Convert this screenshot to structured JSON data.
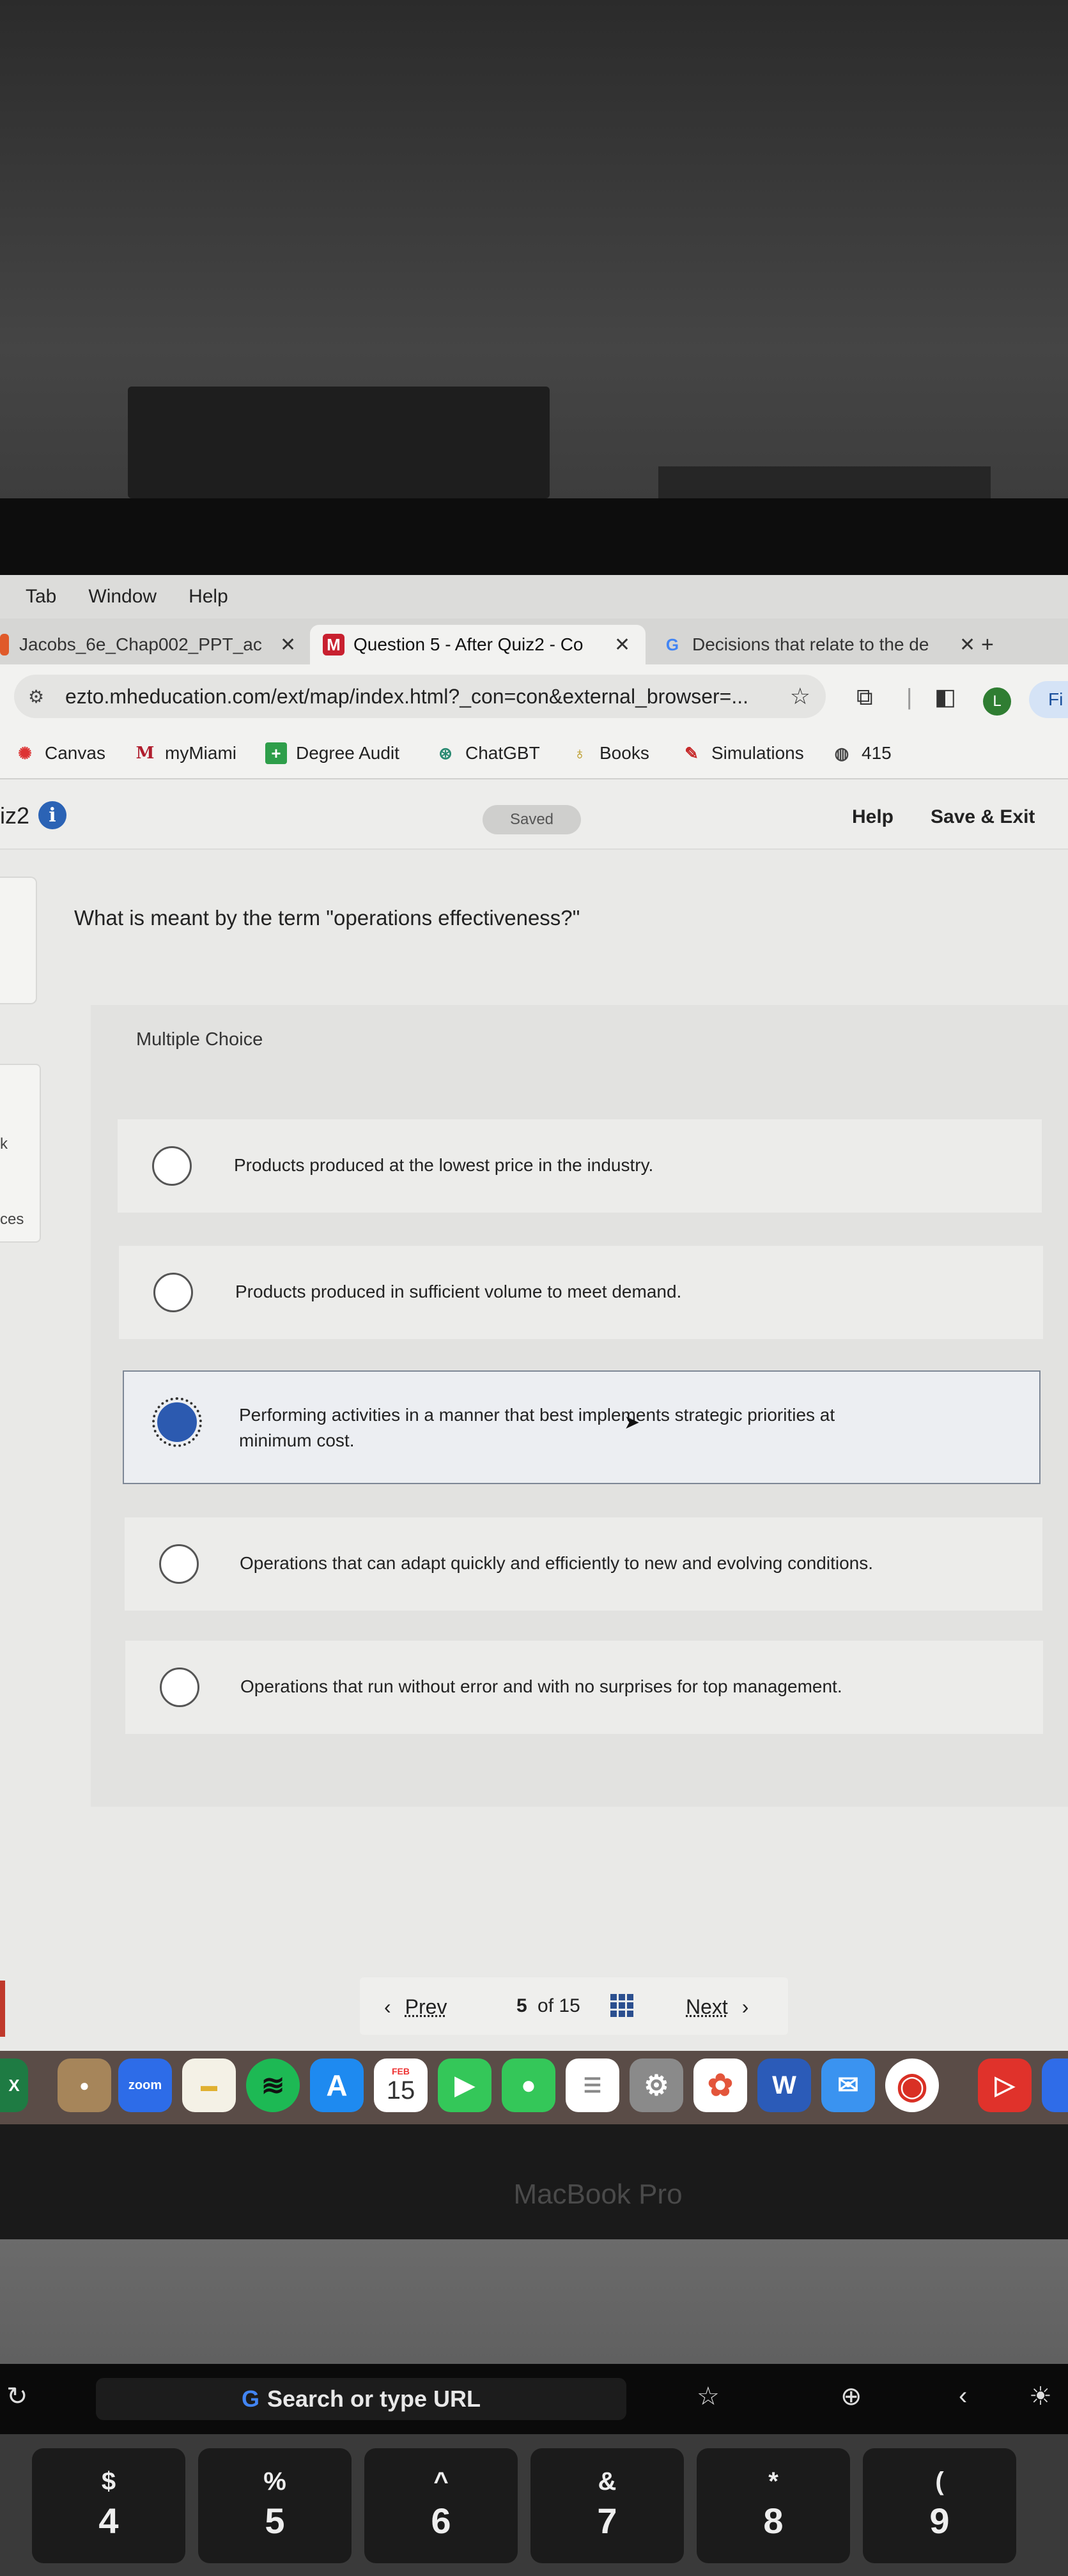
{
  "menubar": {
    "items": [
      "Tab",
      "Window",
      "Help"
    ]
  },
  "tabs": [
    {
      "title": "Jacobs_6e_Chap002_PPT_ac",
      "close": "✕",
      "icon": "slides-icon"
    },
    {
      "title": "Question 5 - After Quiz2 - Co",
      "close": "✕",
      "icon": "mcgraw-hill-icon"
    },
    {
      "title": "Decisions that relate to the de",
      "close": "✕",
      "icon": "google-icon"
    }
  ],
  "new_tab": "+",
  "address": {
    "url": "ezto.mheducation.com/ext/map/index.html?_con=con&external_browser=...",
    "star": "☆"
  },
  "profile_initial": "L",
  "fi_label": "Fi",
  "bookmarks": [
    "Canvas",
    "myMiami",
    "Degree Audit",
    "ChatGBT",
    "Books",
    "Simulations",
    "415"
  ],
  "header": {
    "title": "iz2",
    "saved": "Saved",
    "help": "Help",
    "save_exit": "Save & Exit"
  },
  "sidepanel": {
    "a": "k",
    "b": "ces"
  },
  "question": {
    "prompt": "What is meant by the term \"operations effectiveness?\"",
    "type_label": "Multiple Choice",
    "options": [
      "Products produced at the lowest price in the industry.",
      "Products produced in sufficient volume to meet demand.",
      "Performing activities in a manner that best implements strategic priorities at minimum cost.",
      "Operations that can adapt quickly and efficiently to new and evolving conditions.",
      "Operations that run without error and with no surprises for top management."
    ],
    "selected_index": 2
  },
  "nav": {
    "prev": "Prev",
    "current": "5",
    "of": "of 15",
    "next": "Next"
  },
  "dock": {
    "zoom": "zoom",
    "calendar_month": "FEB",
    "calendar_day": "15",
    "word": "W",
    "excel": "X"
  },
  "laptop": {
    "model": "MacBook Pro",
    "touchbar_search": "Search or type URL"
  },
  "keys": [
    {
      "top": "$",
      "bottom": "4"
    },
    {
      "top": "%",
      "bottom": "5"
    },
    {
      "top": "^",
      "bottom": "6"
    },
    {
      "top": "&",
      "bottom": "7"
    },
    {
      "top": "*",
      "bottom": "8"
    },
    {
      "top": "(",
      "bottom": "9"
    }
  ],
  "colors": {
    "accent": "#2c5ab0",
    "page_bg": "#e9e9e7",
    "choice_bg": "#e2e2e0"
  }
}
